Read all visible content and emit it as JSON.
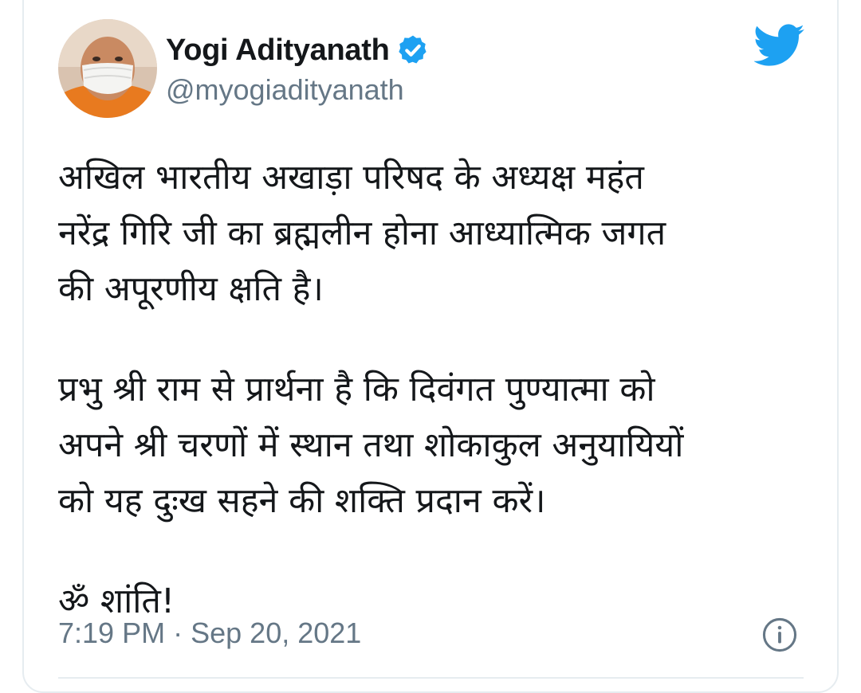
{
  "author": {
    "display_name": "Yogi Adityanath",
    "handle": "@myogiadityanath",
    "verified": true,
    "avatar_icon": "profile-photo"
  },
  "tweet": {
    "lines_paragraph_1": [
      "अखिल भारतीय अखाड़ा परिषद के अध्यक्ष महंत",
      "नरेंद्र गिरि जी का ब्रह्मलीन होना आध्यात्मिक जगत",
      "की अपूरणीय क्षति है।"
    ],
    "lines_paragraph_2": [
      "प्रभु श्री राम से प्रार्थना है कि दिवंगत पुण्यात्मा को",
      "अपने श्री चरणों में स्थान तथा शोकाकुल अनुयायियों",
      "को यह दुःख सहने की शक्ति प्रदान करें।"
    ],
    "line_paragraph_3": "ॐ शांति!"
  },
  "meta": {
    "time": "7:19 PM",
    "separator": "·",
    "date": "Sep 20, 2021"
  },
  "icons": {
    "verified": "verified-badge-icon",
    "platform": "twitter-bird-icon",
    "info": "info-icon"
  },
  "colors": {
    "twitter_blue": "#1da1f2",
    "text": "#14171a",
    "secondary_text": "#657786",
    "border": "#e6ecf0"
  }
}
